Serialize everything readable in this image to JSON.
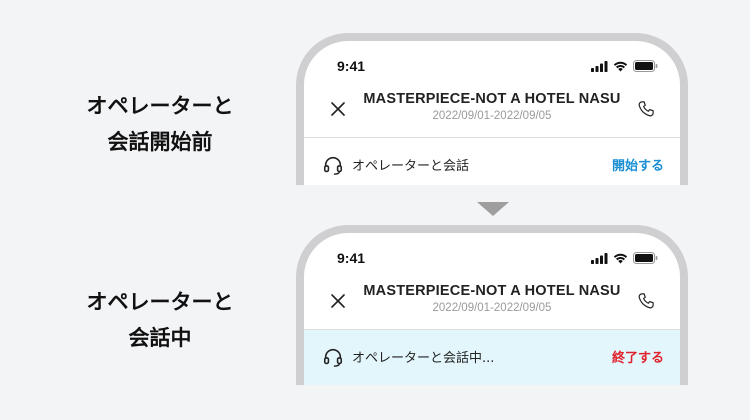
{
  "colors": {
    "start_action": "#1a8fd4",
    "end_action": "#e0222d",
    "active_bar_bg": "#e3f6fb"
  },
  "panels": [
    {
      "caption_line1": "オペレーターと",
      "caption_line2": "会話開始前",
      "status_time": "9:41",
      "hotel_name": "MASTERPIECE-NOT A HOTEL NASU",
      "dates": "2022/09/01-2022/09/05",
      "bar_label": "オペレーターと会話",
      "action_label": "開始する",
      "icons": [
        "close-icon",
        "phone-icon",
        "headset-icon",
        "signal-icon",
        "wifi-icon",
        "battery-icon"
      ]
    },
    {
      "caption_line1": "オペレーターと",
      "caption_line2": "会話中",
      "status_time": "9:41",
      "hotel_name": "MASTERPIECE-NOT A HOTEL NASU",
      "dates": "2022/09/01-2022/09/05",
      "bar_label": "オペレーターと会話中...",
      "action_label": "終了する",
      "icons": [
        "close-icon",
        "phone-icon",
        "headset-icon",
        "signal-icon",
        "wifi-icon",
        "battery-icon"
      ]
    }
  ],
  "transition_icon": "down-arrow-icon"
}
